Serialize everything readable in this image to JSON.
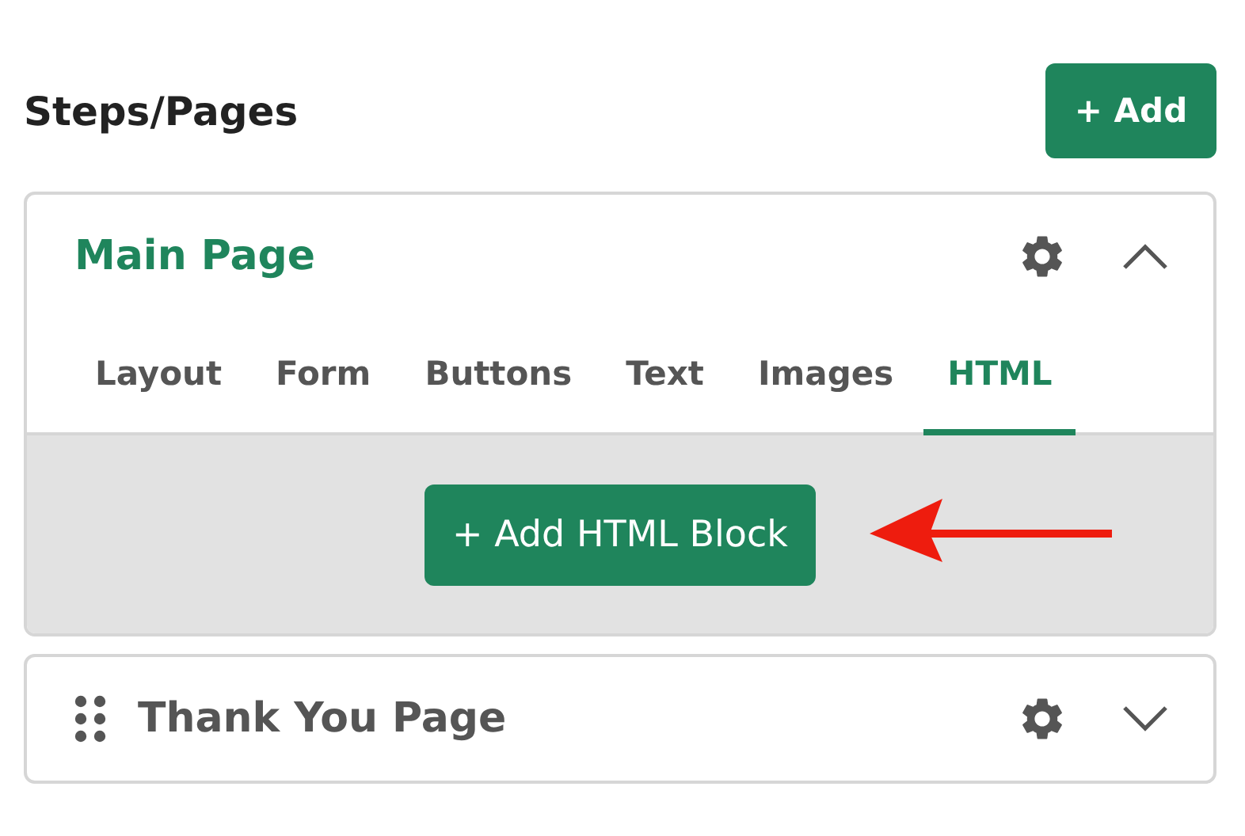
{
  "heading": "Steps/Pages",
  "add_button": "+ Add",
  "pages": [
    {
      "title": "Main Page",
      "expanded": true,
      "draggable": false,
      "tabs": [
        {
          "label": "Layout",
          "selected": false
        },
        {
          "label": "Form",
          "selected": false
        },
        {
          "label": "Buttons",
          "selected": false
        },
        {
          "label": "Text",
          "selected": false
        },
        {
          "label": "Images",
          "selected": false
        },
        {
          "label": "HTML",
          "selected": true
        }
      ],
      "add_block_button": "+ Add HTML Block",
      "annotation": {
        "kind": "arrow",
        "color": "#ee1c0e"
      }
    },
    {
      "title": "Thank You Page",
      "expanded": false,
      "draggable": true
    }
  ]
}
